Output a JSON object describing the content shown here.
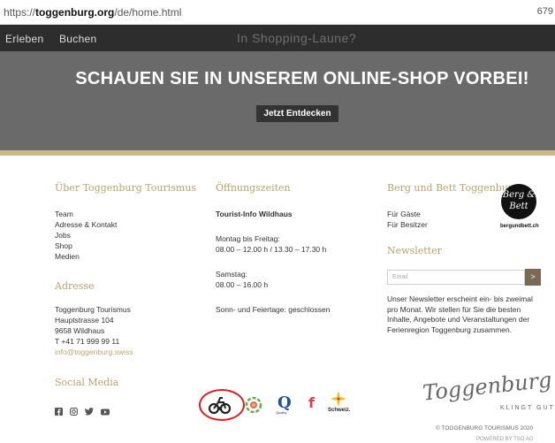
{
  "browser": {
    "url_prefix": "https://",
    "url_domain": "toggenburg.org",
    "url_path": "/de/home.html",
    "zoom": "679"
  },
  "nav": {
    "items": [
      "Erleben",
      "Buchen"
    ],
    "promo": "In Shopping-Laune?"
  },
  "banner": {
    "headline": "SCHAUEN SIE IN UNSEREM ONLINE-SHOP VORBEI!",
    "cta": "Jetzt Entdecken"
  },
  "footer": {
    "about": {
      "heading": "Über Toggenburg Tourismus",
      "links": [
        "Team",
        "Adresse & Kontakt",
        "Jobs",
        "Shop",
        "Medien"
      ]
    },
    "address": {
      "heading": "Adresse",
      "lines": [
        "Toggenburg Tourismus",
        "Hauptstrasse 104",
        "9658 Wildhaus",
        "T +41 71 999 99 11"
      ],
      "email": "info@toggenburg.swiss"
    },
    "social": {
      "heading": "Social Media",
      "icons": [
        "facebook-icon",
        "instagram-icon",
        "twitter-icon",
        "youtube-icon"
      ]
    },
    "hours": {
      "heading": "Öffnungszeiten",
      "office": "Tourist-Info Wildhaus",
      "weekday_label": "Montag bis Freitag:",
      "weekday_hours": "08.00 – 12.00 h / 13.30 – 17.30 h",
      "saturday_label": "Samstag:",
      "saturday_hours": "08.00 – 16.00 h",
      "holiday": "Sonn- und Feiertage: geschlossen"
    },
    "partners": {
      "labels": [
        "Quality",
        "Schweiz."
      ]
    },
    "bergbett": {
      "heading": "Berg und Bett Toggenburg",
      "links": [
        "Für Gäste",
        "Für Besitzer"
      ],
      "logo_text": "Berg & Bett",
      "logo_sub": "bergundbett.ch"
    },
    "newsletter": {
      "heading": "Newsletter",
      "placeholder": "Email",
      "button": ">",
      "text": "Unser Newsletter erscheint ein- bis zweimal pro Monat. Wir stellen für Sie die besten Inhalte, Angebote und Veranstaltungen der Ferienregion Toggenburg zusammen."
    },
    "brand": {
      "logo": "Toggenburg",
      "tagline": "KLINGT GUT",
      "copyright": "© TOGGENBURG TOURISMUS 2020",
      "powered": "POWERED BY TSO AG"
    }
  },
  "colors": {
    "accent_gold": "#b7a46c",
    "nav_bg": "#2d2d2d",
    "banner_bg": "#6a6a6a",
    "highlight_circle": "#e21b1b"
  }
}
